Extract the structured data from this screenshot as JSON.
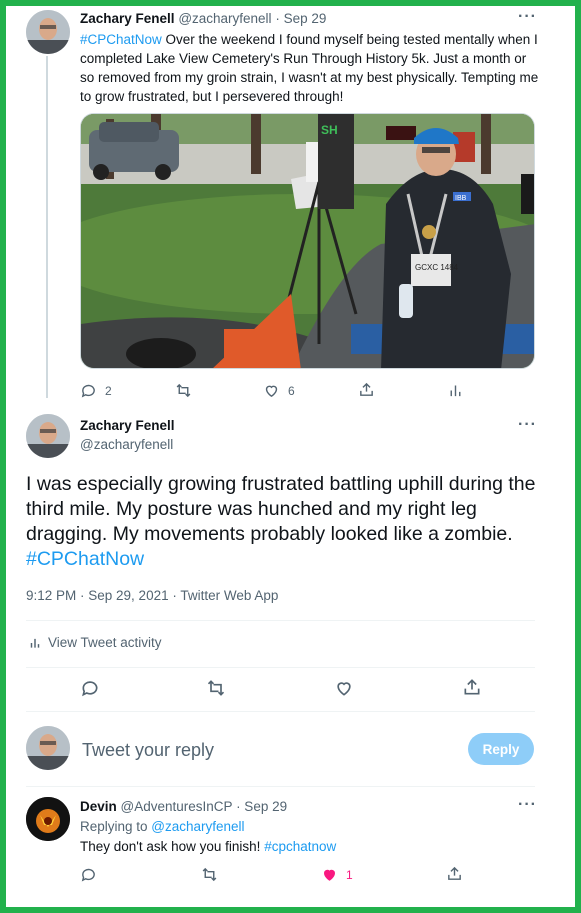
{
  "tweet1": {
    "name": "Zachary Fenell",
    "handle": "@zacharyfenell",
    "date": "· Sep 29",
    "hashtag": "#CPChatNow",
    "text": " Over the weekend I found myself being tested mentally when I completed Lake View Cemetery's Run Through History 5k. Just a month or so removed from my groin strain, I wasn't at my best physically. Tempting me to grow frustrated, but I persevered through!",
    "replies": "2",
    "likes": "6",
    "image_bib": "GCXC 1484",
    "image_brand": "IBB"
  },
  "tweet2": {
    "name": "Zachary Fenell",
    "handle": "@zacharyfenell",
    "text": "I was especially growing frustrated battling uphill during the third mile. My posture was hunched and my right leg dragging. My movements probably looked like a zombie. ",
    "hashtag": "#CPChatNow",
    "meta": "9:12 PM · Sep 29, 2021 · Twitter Web App",
    "activity": "View Tweet activity"
  },
  "compose": {
    "placeholder": "Tweet your reply",
    "reply_button": "Reply"
  },
  "reply": {
    "name": "Devin",
    "handle": "@AdventuresInCP",
    "date": "· Sep 29",
    "replying_prefix": "Replying to ",
    "replying_to": "@zacharyfenell",
    "text": "They don't ask how you finish! ",
    "hashtag": "#cpchatnow",
    "likes": "1"
  },
  "colors": {
    "accent": "#1d9bf0",
    "like": "#f91880",
    "frame": "#22b14c"
  }
}
